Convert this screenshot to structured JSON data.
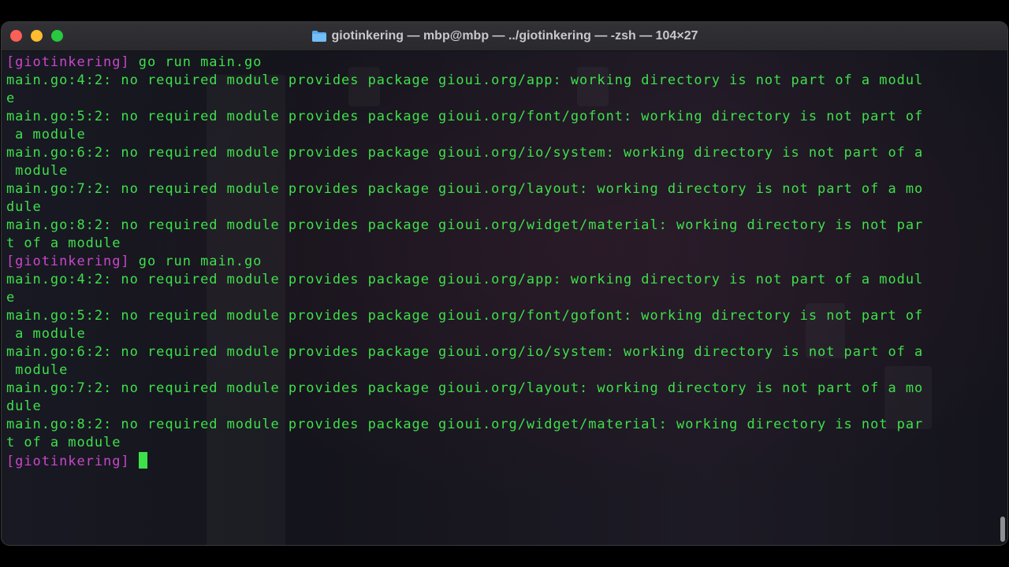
{
  "window": {
    "title": "giotinkering — mbp@mbp — ../giotinkering — -zsh — 104×27",
    "folder_icon": "folder-icon"
  },
  "colors": {
    "output": "#3ee04a",
    "prompt": "#c847c8",
    "background": "#14141b"
  },
  "terminal": {
    "prompt": "[giotinkering]",
    "lines": [
      {
        "type": "prompt",
        "prompt": "[giotinkering]",
        "command": " go run main.go"
      },
      {
        "type": "output",
        "text": "main.go:4:2: no required module provides package gioui.org/app: working directory is not part of a modul"
      },
      {
        "type": "output",
        "text": "e"
      },
      {
        "type": "output",
        "text": "main.go:5:2: no required module provides package gioui.org/font/gofont: working directory is not part of"
      },
      {
        "type": "output",
        "text": " a module"
      },
      {
        "type": "output",
        "text": "main.go:6:2: no required module provides package gioui.org/io/system: working directory is not part of a"
      },
      {
        "type": "output",
        "text": " module"
      },
      {
        "type": "output",
        "text": "main.go:7:2: no required module provides package gioui.org/layout: working directory is not part of a mo"
      },
      {
        "type": "output",
        "text": "dule"
      },
      {
        "type": "output",
        "text": "main.go:8:2: no required module provides package gioui.org/widget/material: working directory is not par"
      },
      {
        "type": "output",
        "text": "t of a module"
      },
      {
        "type": "prompt",
        "prompt": "[giotinkering]",
        "command": " go run main.go"
      },
      {
        "type": "output",
        "text": "main.go:4:2: no required module provides package gioui.org/app: working directory is not part of a modul"
      },
      {
        "type": "output",
        "text": "e"
      },
      {
        "type": "output",
        "text": "main.go:5:2: no required module provides package gioui.org/font/gofont: working directory is not part of"
      },
      {
        "type": "output",
        "text": " a module"
      },
      {
        "type": "output",
        "text": "main.go:6:2: no required module provides package gioui.org/io/system: working directory is not part of a"
      },
      {
        "type": "output",
        "text": " module"
      },
      {
        "type": "output",
        "text": "main.go:7:2: no required module provides package gioui.org/layout: working directory is not part of a mo"
      },
      {
        "type": "output",
        "text": "dule"
      },
      {
        "type": "output",
        "text": "main.go:8:2: no required module provides package gioui.org/widget/material: working directory is not par"
      },
      {
        "type": "output",
        "text": "t of a module"
      },
      {
        "type": "prompt",
        "prompt": "[giotinkering]",
        "command": " ",
        "cursor": true
      }
    ]
  }
}
